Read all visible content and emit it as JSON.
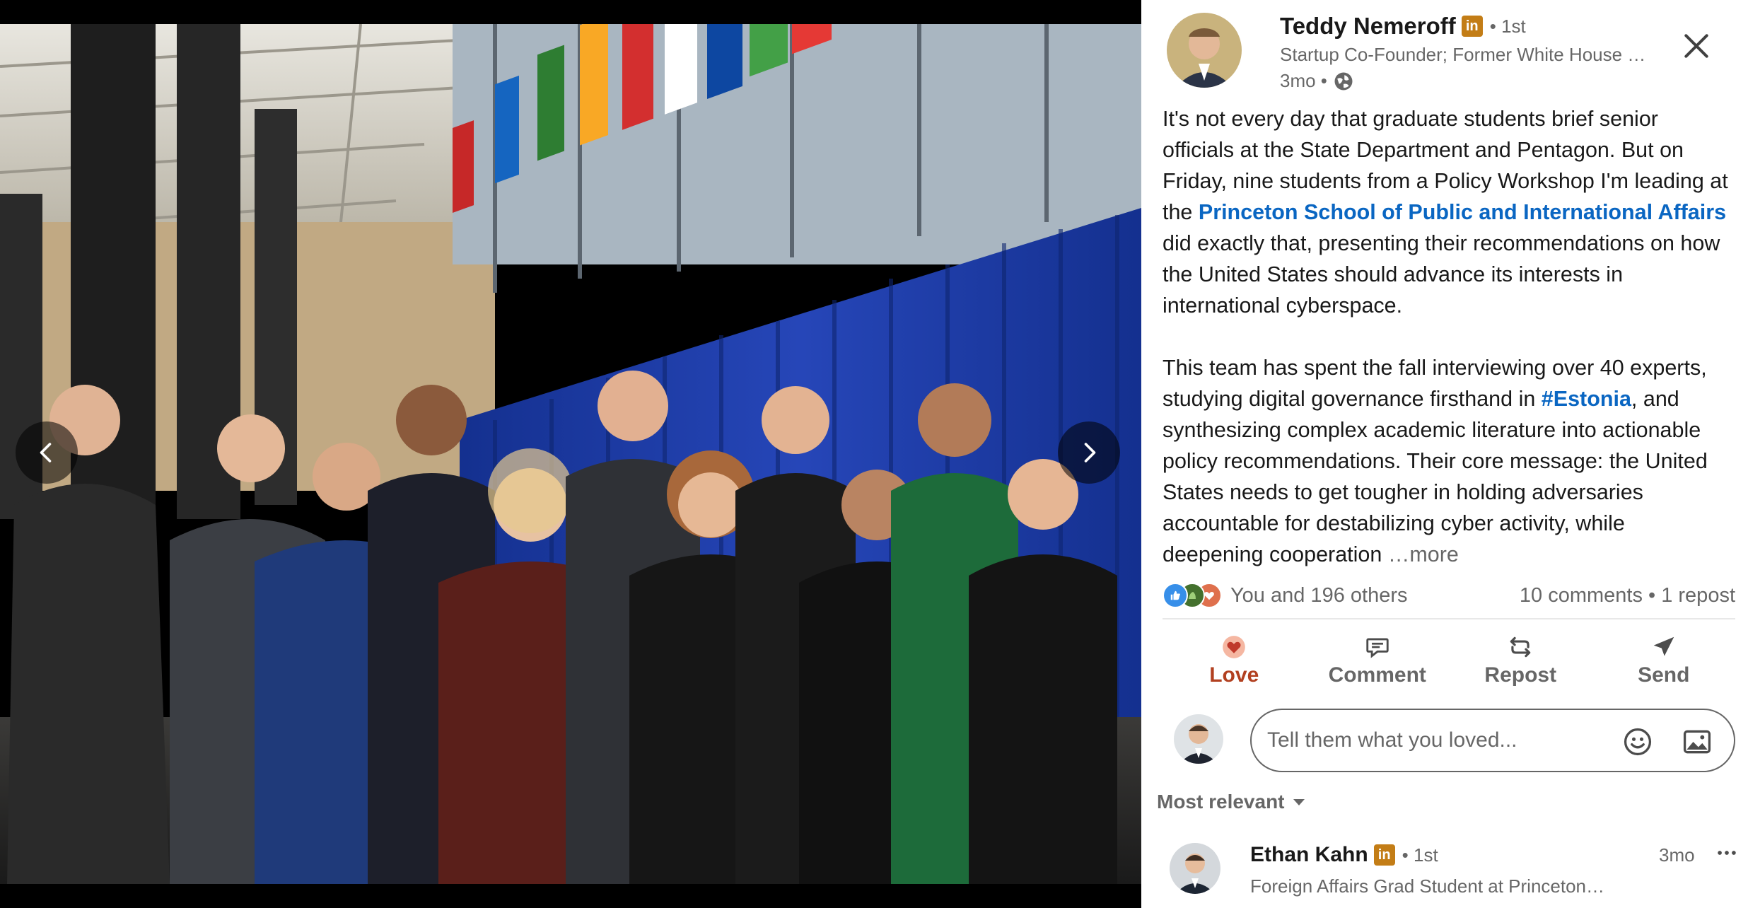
{
  "post": {
    "author": {
      "name": "Teddy Nemeroff",
      "badge": "in",
      "degree": "• 1st",
      "headline": "Startup Co-Founder; Former White House …",
      "time": "3mo •"
    },
    "body": {
      "p1_before": "It's not every day that graduate students brief senior officials at the State Department and Pentagon. But on Friday, nine students from a Policy Workshop I'm leading at the ",
      "p1_link": "Princeton School of Public and International Affairs",
      "p1_after": " did exactly that, presenting their recommendations on how the United States should advance its interests in international cyberspace.",
      "p2_before": "This team has spent the fall interviewing over 40 experts, studying digital governance firsthand in ",
      "p2_hashtag": "#Estonia",
      "p2_after": ", and synthesizing complex academic literature into actionable policy recommendations. Their core message: the United States needs to get tougher in holding adversaries accountable for destabilizing cyber activity, while deepening cooperation ",
      "more": " …more"
    },
    "social": {
      "reactors": "You and 196 others",
      "counts": "10 comments • 1 repost"
    },
    "actions": {
      "love": "Love",
      "comment": "Comment",
      "repost": "Repost",
      "send": "Send"
    },
    "comment_box": {
      "placeholder": "Tell them what you loved..."
    },
    "sort": {
      "label": "Most relevant"
    },
    "comments": [
      {
        "author": "Ethan Kahn",
        "badge": "in",
        "degree": "• 1st",
        "headline": "Foreign Affairs Grad Student at Princeton…",
        "time": "3mo",
        "menu": "•••"
      }
    ]
  },
  "colors": {
    "link": "#0a66c2",
    "love_active": "#b24020",
    "premium_badge": "#c37d16",
    "drape_blue": "#1f3ea8"
  },
  "icons": {
    "prev": "chevron-left-icon",
    "next": "chevron-right-icon",
    "close": "close-icon",
    "visibility": "globe-icon",
    "emoji": "emoji-icon",
    "image": "image-icon"
  }
}
